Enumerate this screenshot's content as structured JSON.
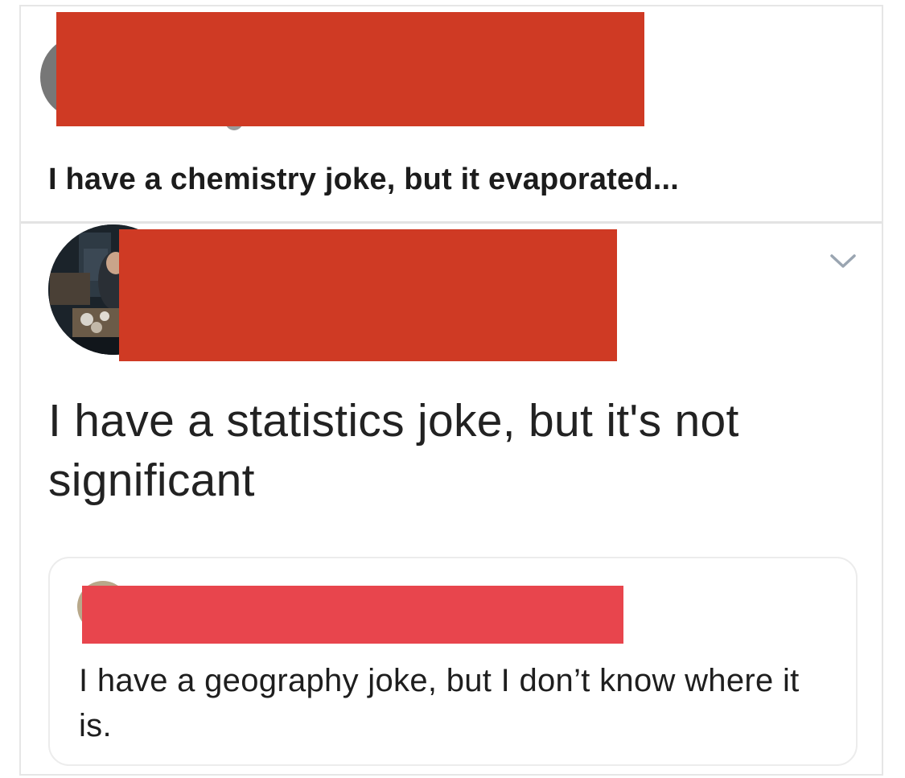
{
  "posts": [
    {
      "text": "I have a chemistry joke, but it evaporated...",
      "author_redacted": true,
      "redaction_color": "#cf3a24"
    },
    {
      "text": "I have a statistics joke, but it's not significant",
      "author_redacted": true,
      "redaction_color": "#cf3a24",
      "menu_icon": "chevron-down-icon",
      "quoted": {
        "text": "I have a geography joke, but I don’t know where it is.",
        "author_redacted": true,
        "redaction_color": "#e8454d"
      }
    }
  ],
  "colors": {
    "border": "#e6e6e6",
    "chevron": "#9aa5b1",
    "text_dark": "#1c1c1c"
  }
}
